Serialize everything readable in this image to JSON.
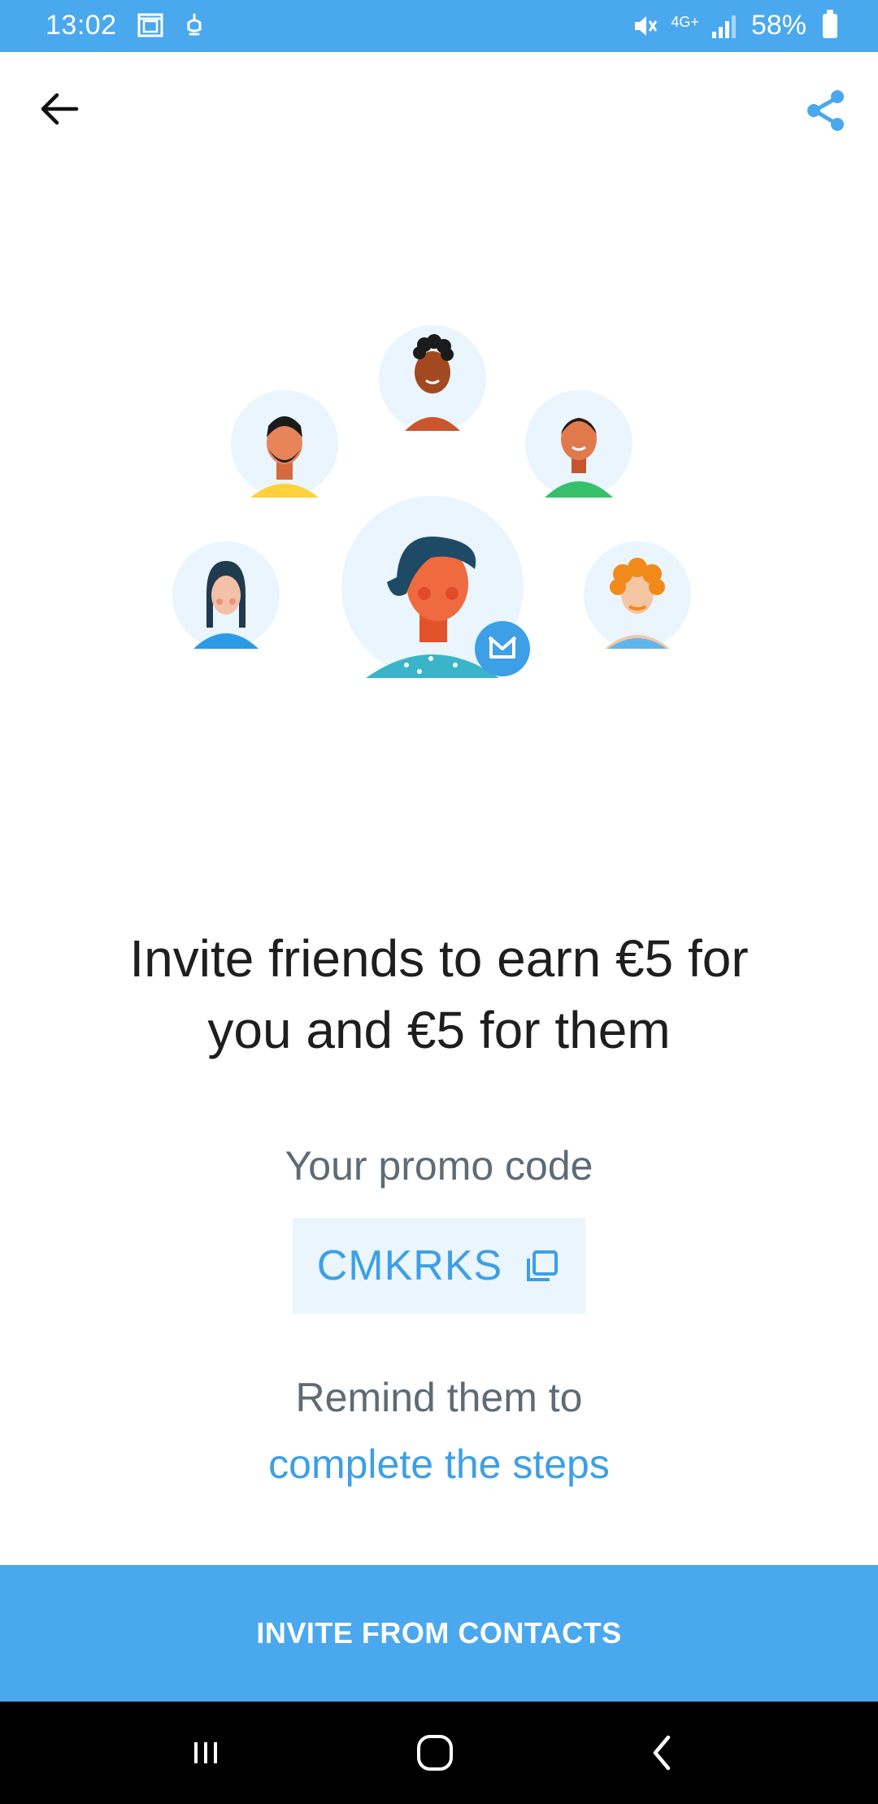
{
  "status_bar": {
    "time": "13:02",
    "network": "4G+",
    "battery": "58%"
  },
  "toolbar": {
    "back_icon": "arrow-left-icon",
    "share_icon": "share-icon"
  },
  "content": {
    "headline_line1": "Invite friends to earn €5 for",
    "headline_line2": "you and €5 for them",
    "promo_label": "Your promo code",
    "promo_code": "CMKRKS",
    "copy_icon": "copy-icon",
    "remind_text": "Remind them to",
    "steps_link": "complete the steps"
  },
  "actions": {
    "invite_button": "INVITE FROM CONTACTS"
  },
  "colors": {
    "accent": "#4aa8ee",
    "link": "#3d9fe6",
    "promo_bg": "#eaf5fd",
    "avatar_bg": "#eaf5fd"
  }
}
